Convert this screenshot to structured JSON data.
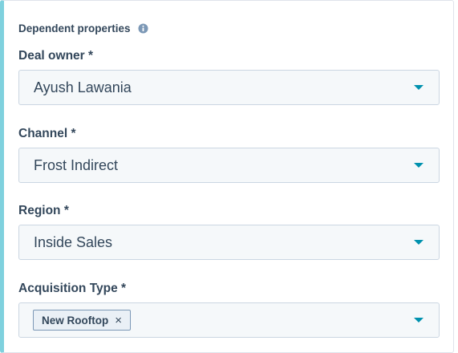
{
  "section": {
    "title": "Dependent properties",
    "info_icon": "info-circle-icon"
  },
  "fields": {
    "deal_owner": {
      "label": "Deal owner *",
      "value": "Ayush Lawania",
      "icon": "caret-down-icon"
    },
    "channel": {
      "label": "Channel *",
      "value": "Frost Indirect",
      "icon": "caret-down-icon"
    },
    "region": {
      "label": "Region *",
      "value": "Inside Sales",
      "icon": "caret-down-icon"
    },
    "acquisition_type": {
      "label": "Acquisition Type *",
      "tags": [
        "New Rooftop"
      ],
      "tag_remove_glyph": "×",
      "icon": "caret-down-icon"
    }
  },
  "colors": {
    "accent_border": "#7fd1de",
    "caret": "#0091ae",
    "text": "#33475b",
    "input_bg": "#f5f8fa",
    "tag_bg": "#eaf0f6"
  }
}
